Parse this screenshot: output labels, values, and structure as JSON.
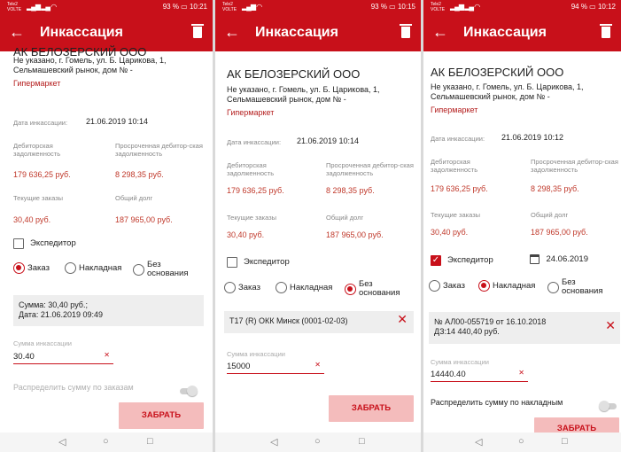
{
  "screens": [
    {
      "status": {
        "carrier": "Tele2 VOLTE",
        "battery": "93 %",
        "time": "10:21"
      },
      "title": "Инкассация",
      "company": "АК БЕЛОЗЕРСКИЙ ООО",
      "address": "Не указано, г. Гомель, ул. Б. Царикова, 1, Сельмашевский рынок, дом № -",
      "store_type": "Гипермаркет",
      "collection_date_label": "Дата инкассации:",
      "collection_date": "21.06.2019 10:14",
      "receivable_label": "Дебиторская задолженность",
      "receivable_value": "179 636,25 руб.",
      "overdue_label": "Просроченная дебитор-ская задолженность",
      "overdue_value": "8 298,35 руб.",
      "current_orders_label": "Текущие заказы",
      "current_orders_value": "30,40 руб.",
      "total_debt_label": "Общий долг",
      "total_debt_value": "187 965,00 руб.",
      "forwarder_label": "Экспедитор",
      "forwarder_checked": false,
      "radio_order": "Заказ",
      "radio_invoice": "Накладная",
      "radio_none": "Без основания",
      "selected_radio": "order",
      "info_line1": "Сумма: 30,40 руб.;",
      "info_line2": "Дата: 21.06.2019 09:49",
      "amount_label": "Сумма инкассации",
      "amount_value": "30.40",
      "distribute_label": "Распределить сумму по заказам",
      "button": "ЗАБРАТЬ"
    },
    {
      "status": {
        "carrier": "Tele2 VOLTE",
        "battery": "93 %",
        "time": "10:15"
      },
      "title": "Инкассация",
      "company": "АК БЕЛОЗЕРСКИЙ ООО",
      "address": "Не указано, г. Гомель, ул. Б. Царикова, 1, Сельмашевский рынок, дом № -",
      "store_type": "Гипермаркет",
      "collection_date_label": "Дата инкассации:",
      "collection_date": "21.06.2019 10:14",
      "receivable_label": "Дебиторская задолженность",
      "receivable_value": "179 636,25 руб.",
      "overdue_label": "Просроченная дебитор-ская задолженность",
      "overdue_value": "8 298,35 руб.",
      "current_orders_label": "Текущие заказы",
      "current_orders_value": "30,40 руб.",
      "total_debt_label": "Общий долг",
      "total_debt_value": "187 965,00 руб.",
      "forwarder_label": "Экспедитор",
      "forwarder_checked": false,
      "radio_order": "Заказ",
      "radio_invoice": "Накладная",
      "radio_none": "Без основания",
      "selected_radio": "none",
      "info_line1": "T17 (R) ОКК Минск (0001-02-03)",
      "amount_label": "Сумма инкассации",
      "amount_value": "15000",
      "button": "ЗАБРАТЬ"
    },
    {
      "status": {
        "carrier": "Tele2 VOLTE",
        "battery": "94 %",
        "time": "10:12"
      },
      "title": "Инкассация",
      "company": "АК БЕЛОЗЕРСКИЙ ООО",
      "address": "Не указано, г. Гомель, ул. Б. Царикова, 1, Сельмашевский рынок, дом № -",
      "store_type": "Гипермаркет",
      "collection_date_label": "Дата инкассации:",
      "collection_date": "21.06.2019 10:12",
      "receivable_label": "Дебиторская задолженность",
      "receivable_value": "179 636,25 руб.",
      "overdue_label": "Просроченная дебитор-ская задолженность",
      "overdue_value": "8 298,35 руб.",
      "current_orders_label": "Текущие заказы",
      "current_orders_value": "30,40 руб.",
      "total_debt_label": "Общий долг",
      "total_debt_value": "187 965,00 руб.",
      "forwarder_label": "Экспедитор",
      "forwarder_checked": true,
      "forwarder_date": "24.06.2019",
      "radio_order": "Заказ",
      "radio_invoice": "Накладная",
      "radio_none": "Без основания",
      "selected_radio": "invoice",
      "info_line1": "№ АЛ00-055719 от 16.10.2018",
      "info_line2": "ДЗ:14 440,40 руб.",
      "amount_label": "Сумма инкассации",
      "amount_value": "14440.40",
      "distribute_label": "Распределить сумму по накладным",
      "button": "ЗАБРАТЬ"
    }
  ],
  "colors": {
    "primary": "#c8101a",
    "button_bg": "#f4bcbc",
    "info_bg": "#eeeeee"
  }
}
